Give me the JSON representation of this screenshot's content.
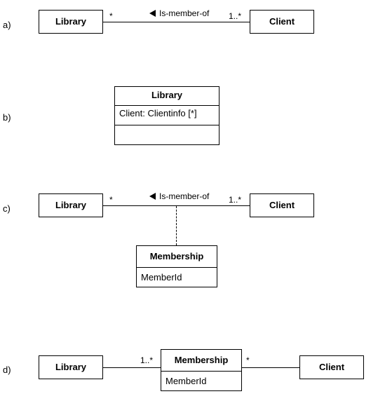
{
  "rows": {
    "a": {
      "label": "a)"
    },
    "b": {
      "label": "b)"
    },
    "c": {
      "label": "c)"
    },
    "d": {
      "label": "d)"
    }
  },
  "a": {
    "library": "Library",
    "client": "Client",
    "assoc_name": "Is-member-of",
    "mult_left": "*",
    "mult_right": "1..*"
  },
  "b": {
    "class_name": "Library",
    "attribute": "Client: Clientinfo [*]"
  },
  "c": {
    "library": "Library",
    "client": "Client",
    "assoc_name": "Is-member-of",
    "mult_left": "*",
    "mult_right": "1..*",
    "assoc_class_name": "Membership",
    "assoc_class_attr": "MemberId"
  },
  "d": {
    "library": "Library",
    "client": "Client",
    "middle_name": "Membership",
    "middle_attr": "MemberId",
    "mult_left": "1..*",
    "mult_right": "*"
  }
}
